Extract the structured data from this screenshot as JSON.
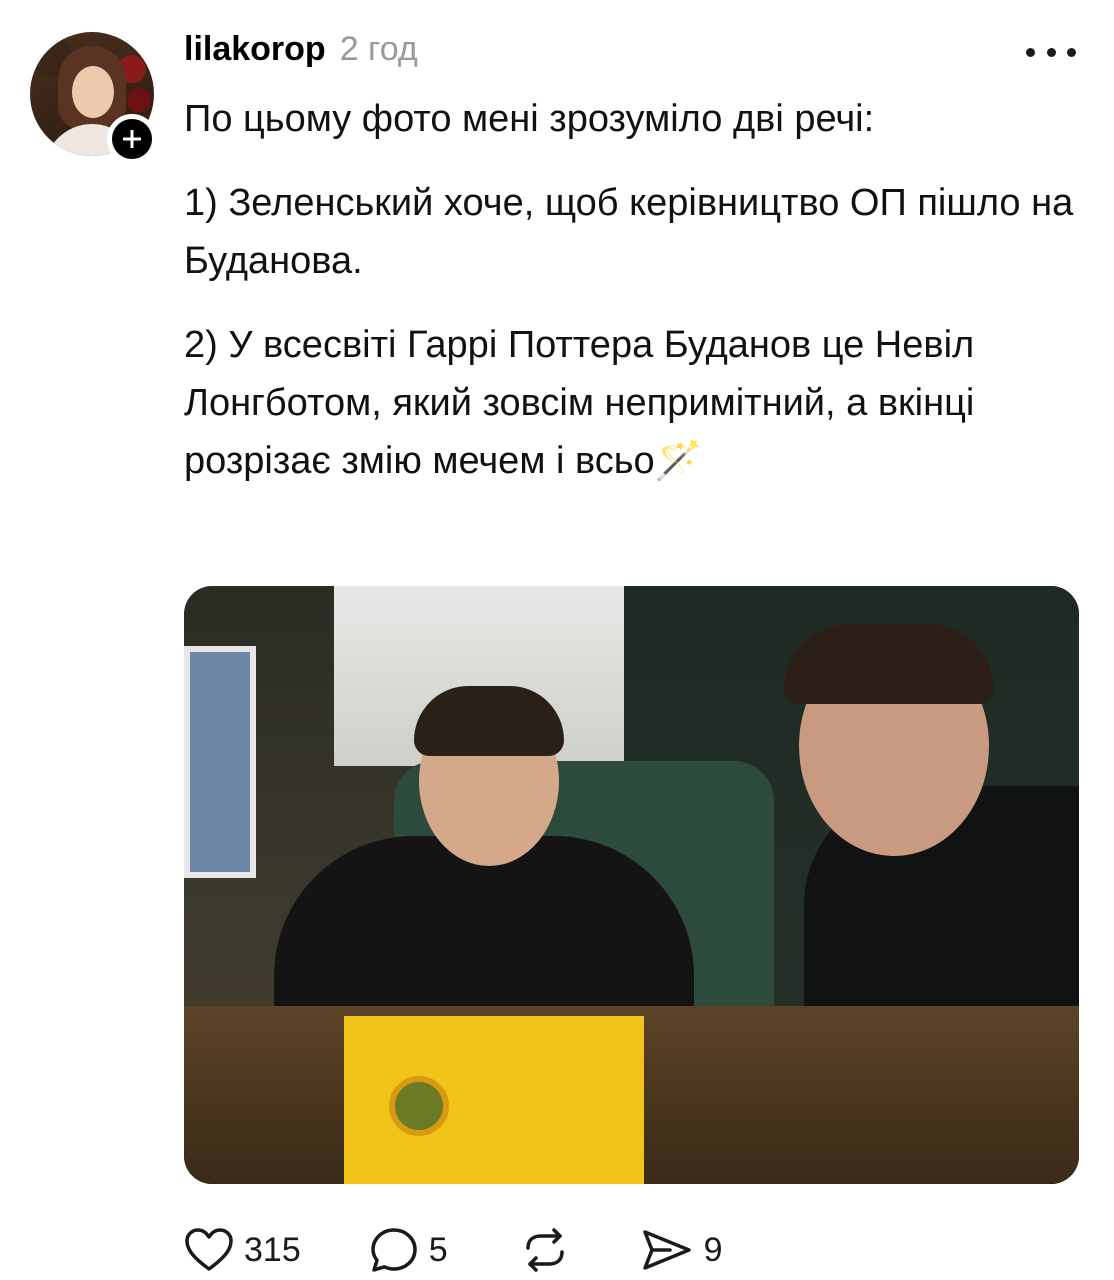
{
  "post": {
    "username": "lilakorop",
    "time": "2 год",
    "text_lines": [
      "По цьому фото мені зрозуміло дві речі:",
      "1) Зеленський хоче, щоб керівництво ОП пішло на Буданова.",
      "2) У всесвіті Гаррі Поттера Буданов це Невіл Лонгботом, який зовсім непримітний, а вкінці розрізає змію мечем і всьо🪄"
    ]
  },
  "actions": {
    "likes": "315",
    "replies": "5",
    "shares": "9"
  },
  "icons": {
    "follow": "plus-icon",
    "more": "more-horizontal-icon",
    "like": "heart-icon",
    "reply": "comment-icon",
    "repost": "repost-icon",
    "share": "send-icon"
  }
}
